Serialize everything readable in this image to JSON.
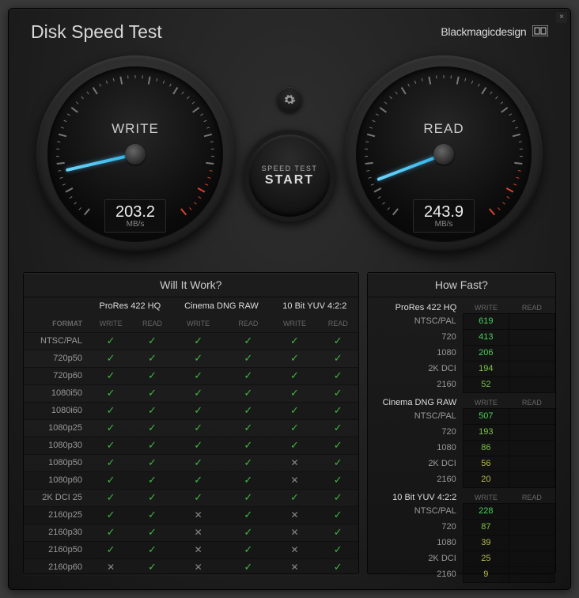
{
  "app_title": "Disk Speed Test",
  "brand": "Blackmagicdesign",
  "panels": {
    "left_title": "Will It Work?",
    "right_title": "How Fast?"
  },
  "gauges": {
    "write": {
      "label": "WRITE",
      "value": "203.2",
      "unit": "MB/s",
      "angle": 167
    },
    "read": {
      "label": "READ",
      "value": "243.9",
      "unit": "MB/s",
      "angle": 159
    }
  },
  "buttons": {
    "start_l1": "SPEED TEST",
    "start_l2": "START"
  },
  "headers": {
    "format": "FORMAT",
    "codecs": [
      "ProRes 422 HQ",
      "Cinema DNG RAW",
      "10 Bit YUV 4:2:2"
    ],
    "sub": [
      "WRITE",
      "READ"
    ]
  },
  "rows": [
    {
      "f": "NTSC/PAL",
      "c": [
        "y",
        "y",
        "y",
        "y",
        "y",
        "y"
      ]
    },
    {
      "f": "720p50",
      "c": [
        "y",
        "y",
        "y",
        "y",
        "y",
        "y"
      ]
    },
    {
      "f": "720p60",
      "c": [
        "y",
        "y",
        "y",
        "y",
        "y",
        "y"
      ]
    },
    {
      "f": "1080i50",
      "c": [
        "y",
        "y",
        "y",
        "y",
        "y",
        "y"
      ]
    },
    {
      "f": "1080i60",
      "c": [
        "y",
        "y",
        "y",
        "y",
        "y",
        "y"
      ]
    },
    {
      "f": "1080p25",
      "c": [
        "y",
        "y",
        "y",
        "y",
        "y",
        "y"
      ]
    },
    {
      "f": "1080p30",
      "c": [
        "y",
        "y",
        "y",
        "y",
        "y",
        "y"
      ]
    },
    {
      "f": "1080p50",
      "c": [
        "y",
        "y",
        "y",
        "y",
        "n",
        "y"
      ]
    },
    {
      "f": "1080p60",
      "c": [
        "y",
        "y",
        "y",
        "y",
        "n",
        "y"
      ]
    },
    {
      "f": "2K DCI 25",
      "c": [
        "y",
        "y",
        "y",
        "y",
        "y",
        "y"
      ]
    },
    {
      "f": "2160p25",
      "c": [
        "y",
        "y",
        "n",
        "y",
        "n",
        "y"
      ]
    },
    {
      "f": "2160p30",
      "c": [
        "y",
        "y",
        "n",
        "y",
        "n",
        "y"
      ]
    },
    {
      "f": "2160p50",
      "c": [
        "y",
        "y",
        "n",
        "y",
        "n",
        "y"
      ]
    },
    {
      "f": "2160p60",
      "c": [
        "n",
        "y",
        "n",
        "y",
        "n",
        "y"
      ]
    }
  ],
  "fast": [
    {
      "name": "ProRes 422 HQ",
      "rows": [
        {
          "f": "NTSC/PAL",
          "w": "619",
          "cls": "green"
        },
        {
          "f": "720",
          "w": "413",
          "cls": "green"
        },
        {
          "f": "1080",
          "w": "206",
          "cls": "green"
        },
        {
          "f": "2K DCI",
          "w": "194",
          "cls": "greenish"
        },
        {
          "f": "2160",
          "w": "52",
          "cls": "greenish"
        }
      ]
    },
    {
      "name": "Cinema DNG RAW",
      "rows": [
        {
          "f": "NTSC/PAL",
          "w": "507",
          "cls": "green"
        },
        {
          "f": "720",
          "w": "193",
          "cls": "greenish"
        },
        {
          "f": "1080",
          "w": "86",
          "cls": "greenish"
        },
        {
          "f": "2K DCI",
          "w": "56",
          "cls": "yellow"
        },
        {
          "f": "2160",
          "w": "20",
          "cls": "yellow"
        }
      ]
    },
    {
      "name": "10 Bit YUV 4:2:2",
      "rows": [
        {
          "f": "NTSC/PAL",
          "w": "228",
          "cls": "green"
        },
        {
          "f": "720",
          "w": "87",
          "cls": "greenish"
        },
        {
          "f": "1080",
          "w": "39",
          "cls": "yellow"
        },
        {
          "f": "2K DCI",
          "w": "25",
          "cls": "yellow"
        },
        {
          "f": "2160",
          "w": "9",
          "cls": "yellow"
        }
      ]
    }
  ]
}
